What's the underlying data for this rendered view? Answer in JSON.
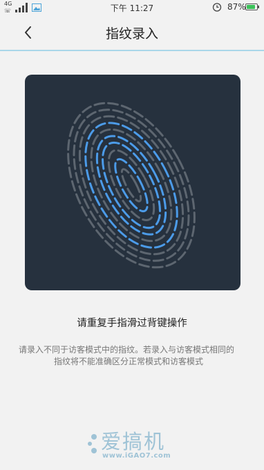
{
  "status_bar": {
    "network": "4G",
    "time": "下午 11:27",
    "battery_percent": "87%",
    "battery_level": 0.87,
    "battery_color": "#3cc15a"
  },
  "header": {
    "title": "指纹录入",
    "back_icon": "chevron-left-icon"
  },
  "fingerprint": {
    "icon": "fingerprint-icon",
    "panel_color": "#26313e",
    "progress_color": "#4c9be8",
    "idle_color": "#5d6670"
  },
  "instruction": "请重复手指滑过背键操作",
  "note": {
    "line1": "请录入不同于访客模式中的指纹。若录入与访客模式相同的",
    "line2": "指纹将不能准确区分正常模式和访客模式"
  },
  "watermark": {
    "text": "爱搞机",
    "url": "www.iGAO7.com"
  }
}
